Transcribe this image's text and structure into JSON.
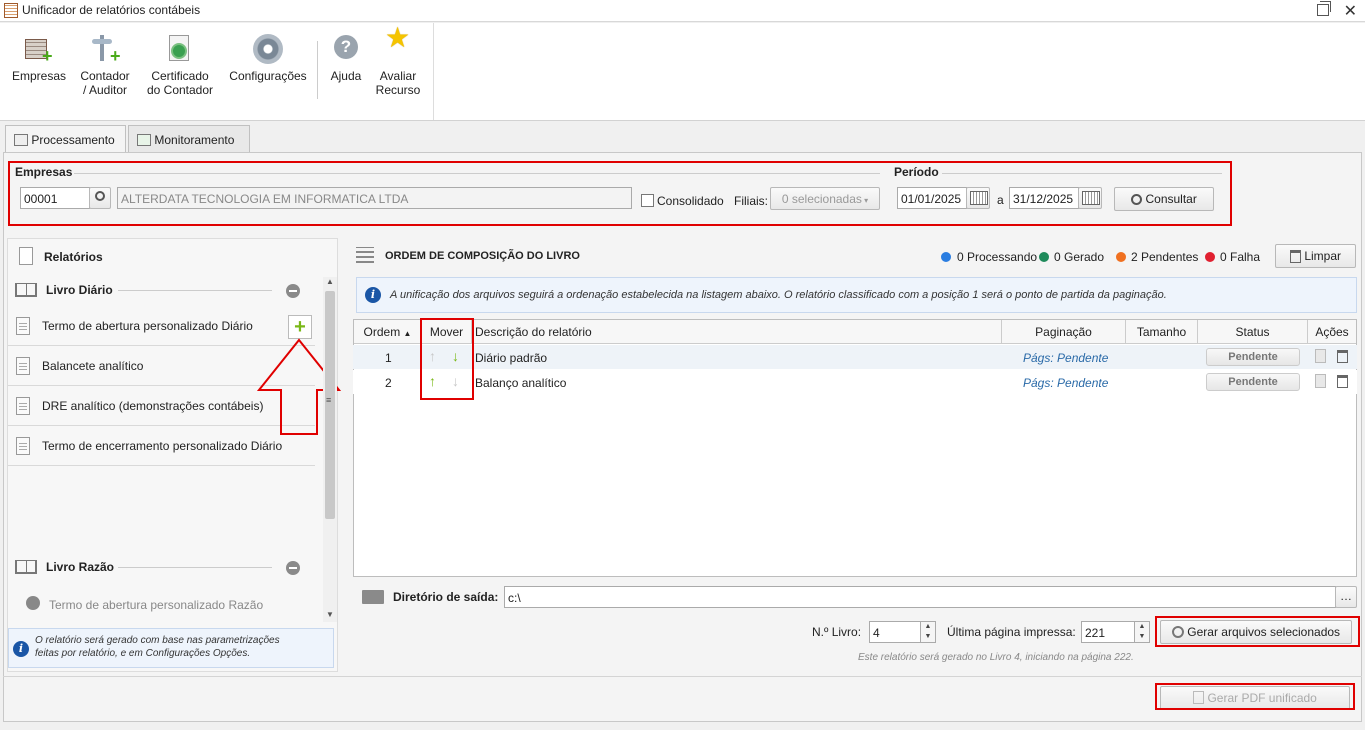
{
  "window": {
    "title": "Unificador de relatórios contábeis"
  },
  "ribbon": {
    "empresas": "Empresas",
    "contador_l1": "Contador",
    "contador_l2": "/ Auditor",
    "certificado_l1": "Certificado",
    "certificado_l2": "do Contador",
    "configuracoes": "Configurações",
    "ajuda": "Ajuda",
    "avaliar_l1": "Avaliar",
    "avaliar_l2": "Recurso"
  },
  "tabs": {
    "processamento": "Processamento",
    "monitoramento": "Monitoramento"
  },
  "filters": {
    "empresas_label": "Empresas",
    "company_code": "00001",
    "company_name": "ALTERDATA TECNOLOGIA EM INFORMATICA LTDA",
    "consolidado": "Consolidado",
    "filiais_label": "Filiais:",
    "filiais_value": "0 selecionadas",
    "periodo_label": "Período",
    "date_from": "01/01/2025",
    "date_sep": "a",
    "date_to": "31/12/2025",
    "consultar": "Consultar"
  },
  "left": {
    "title": "Relatórios",
    "group1": "Livro Diário",
    "items1": [
      "Termo de abertura personalizado Diário",
      "Balancete analítico",
      "DRE analítico (demonstrações contábeis)",
      "Termo de encerramento personalizado Diário"
    ],
    "group2": "Livro Razão",
    "items2": [
      "Termo de abertura personalizado Razão"
    ],
    "info_l1": "O relatório será gerado com base nas parametrizações",
    "info_l2": "feitas por relatório, e em Configurações Opções."
  },
  "right": {
    "title": "ORDEM DE COMPOSIÇÃO DO LIVRO",
    "status": {
      "processando": "0 Processando",
      "gerado": "0 Gerado",
      "pendentes": "2 Pendentes",
      "falha": "0 Falha"
    },
    "limpar": "Limpar",
    "info": "A unificação dos arquivos seguirá a ordenação estabelecida na listagem abaixo. O relatório classificado com a posição 1 será o ponto de partida da paginação.",
    "columns": {
      "ordem": "Ordem",
      "mover": "Mover",
      "descricao": "Descrição do relatório",
      "paginacao": "Paginação",
      "tamanho": "Tamanho",
      "status": "Status",
      "acoes": "Ações"
    },
    "rows": [
      {
        "ordem": "1",
        "descricao": "Diário padrão",
        "paginacao": "Págs: Pendente",
        "status": "Pendente"
      },
      {
        "ordem": "2",
        "descricao": "Balanço analítico",
        "paginacao": "Págs: Pendente",
        "status": "Pendente"
      }
    ],
    "dir_label": "Diretório de saída:",
    "dir_value": "c:\\",
    "nlivro_label": "N.º Livro:",
    "nlivro_value": "4",
    "ultima_label": "Última página impressa:",
    "ultima_value": "221",
    "gerar_sel": "Gerar arquivos selecionados",
    "note": "Este relatório será gerado no Livro 4, iniciando na página 222."
  },
  "footer": {
    "gerar_pdf": "Gerar PDF unificado"
  },
  "colors": {
    "processando": "#2a7de1",
    "gerado": "#1e8a5a",
    "pendentes": "#f07020",
    "falha": "#e02030",
    "highlight": "#e00000"
  }
}
